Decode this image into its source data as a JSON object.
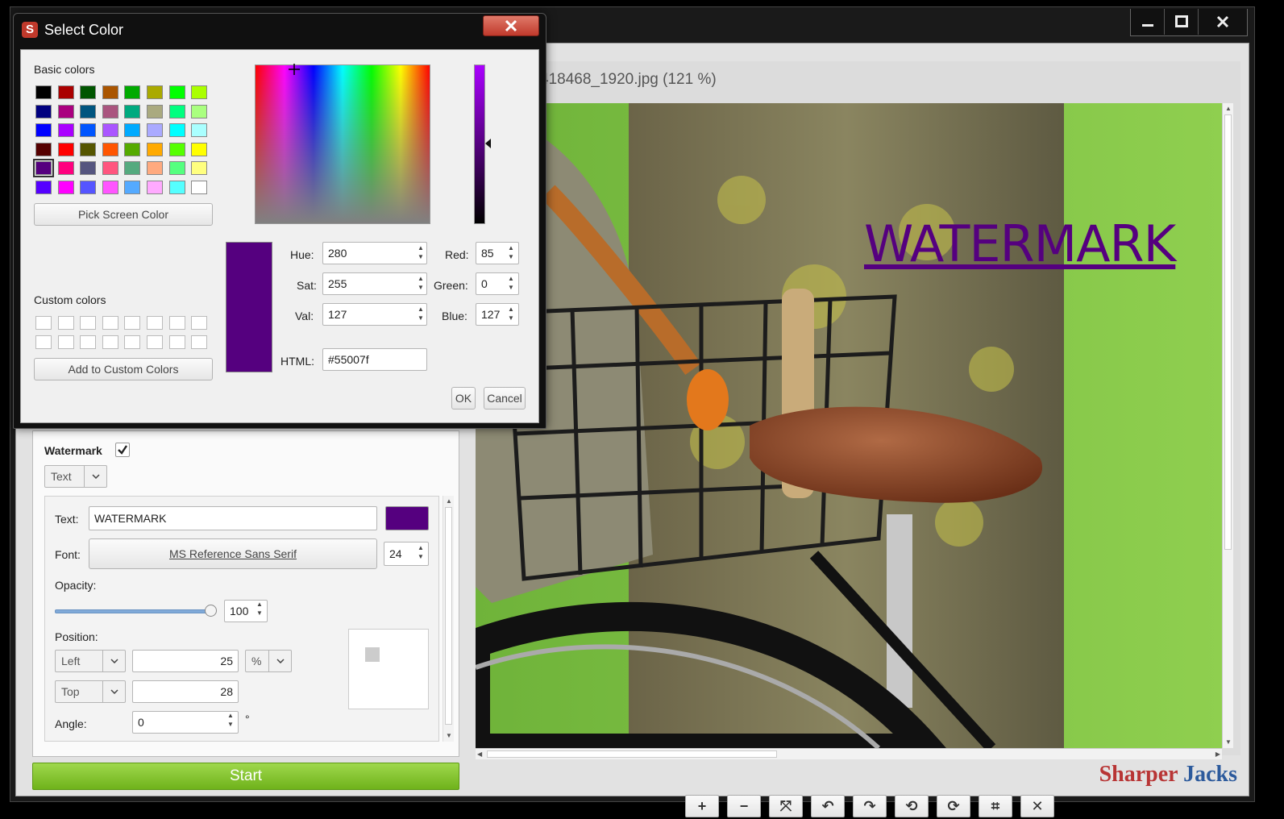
{
  "window": {
    "title_partial": "418468_1920.jpg  (121 %)"
  },
  "watermark_preview": {
    "text": "WATERMARK",
    "color": "#55007f"
  },
  "toolbar": {
    "buttons": [
      "+",
      "−",
      "⤧",
      "↶",
      "↷",
      "⟲",
      "⟳",
      "⌗",
      "✕"
    ]
  },
  "brand": {
    "part1": "Sharper",
    "part2": "Jacks"
  },
  "panel": {
    "section_label": "Watermark",
    "enabled": true,
    "type_value": "Text",
    "text_label": "Text:",
    "text_value": "WATERMARK",
    "text_color": "#55007f",
    "font_label": "Font:",
    "font_value": "MS Reference Sans Serif",
    "font_size": "24",
    "opacity_label": "Opacity:",
    "opacity_value": "100",
    "position_label": "Position:",
    "horiz_anchor": "Left",
    "horiz_value": "25",
    "unit": "%",
    "vert_anchor": "Top",
    "vert_value": "28",
    "angle_label": "Angle:",
    "angle_value": "0",
    "angle_unit": "°"
  },
  "start_button": "Start",
  "dialog": {
    "title": "Select Color",
    "basic_colors_label": "Basic colors",
    "basic_colors": [
      "#000000",
      "#aa0000",
      "#005500",
      "#aa5500",
      "#00aa00",
      "#aaaa00",
      "#00ff00",
      "#aaff00",
      "#00007f",
      "#aa007f",
      "#00557f",
      "#aa557f",
      "#00aa7f",
      "#aaaa7f",
      "#00ff7f",
      "#aaff7f",
      "#0000ff",
      "#aa00ff",
      "#0055ff",
      "#aa55ff",
      "#00aaff",
      "#aaaaff",
      "#00ffff",
      "#aaffff",
      "#550000",
      "#ff0000",
      "#555500",
      "#ff5500",
      "#55aa00",
      "#ffaa00",
      "#55ff00",
      "#ffff00",
      "#55007f",
      "#ff007f",
      "#55557f",
      "#ff557f",
      "#55aa7f",
      "#ffaa7f",
      "#55ff7f",
      "#ffff7f",
      "#5500ff",
      "#ff00ff",
      "#5555ff",
      "#ff55ff",
      "#55aaff",
      "#ffaaff",
      "#55ffff",
      "#ffffff"
    ],
    "pick_screen_label": "Pick Screen Color",
    "custom_colors_label": "Custom colors",
    "add_custom_label": "Add to Custom Colors",
    "hue_label": "Hue:",
    "hue": "280",
    "sat_label": "Sat:",
    "sat": "255",
    "val_label": "Val:",
    "val": "127",
    "red_label": "Red:",
    "red": "85",
    "green_label": "Green:",
    "green": "0",
    "blue_label": "Blue:",
    "blue": "127",
    "html_label": "HTML:",
    "html": "#55007f",
    "ok_label": "OK",
    "cancel_label": "Cancel",
    "current_color": "#55007f"
  }
}
